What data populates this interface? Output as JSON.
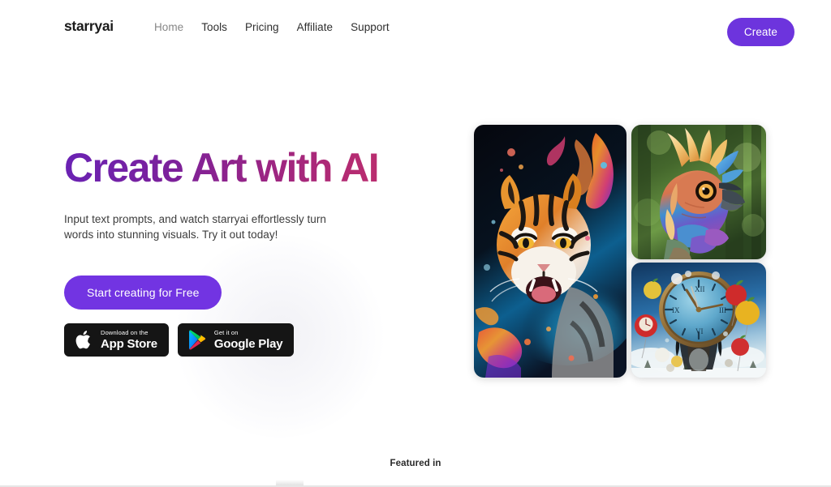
{
  "brand": {
    "name": "starryai"
  },
  "nav": {
    "links": [
      {
        "label": "Home",
        "state": "muted"
      },
      {
        "label": "Tools",
        "state": "normal"
      },
      {
        "label": "Pricing",
        "state": "normal"
      },
      {
        "label": "Affiliate",
        "state": "normal"
      },
      {
        "label": "Support",
        "state": "normal"
      }
    ],
    "create_label": "Create",
    "create_color": "#6d34dd"
  },
  "hero": {
    "headline": "Create Art with AI",
    "headline_gradient_from": "#6a22b4",
    "headline_gradient_to": "#c2306b",
    "subhead": "Input text prompts, and watch starryai effortlessly turn words into stunning visuals. Try it out today!",
    "cta_label": "Start creating for Free",
    "cta_color": "#7234e2"
  },
  "store_badges": [
    {
      "icon": "apple-logo-icon",
      "small_label": "Download on the",
      "big_label": "App Store"
    },
    {
      "icon": "google-play-icon",
      "small_label": "Get it on",
      "big_label": "Google Play"
    }
  ],
  "gallery": [
    {
      "name": "tiger-artwork",
      "alt": "Colorful painted tiger head with orange and cyan paint splashes on dark background"
    },
    {
      "name": "bird-artwork",
      "alt": "Vibrant crested bird with blue, orange and purple feathers in a green forest"
    },
    {
      "name": "clock-artwork",
      "alt": "Surreal melting clock with floating apple balloons in a blue sky"
    }
  ],
  "footer": {
    "featured_label": "Featured in"
  }
}
